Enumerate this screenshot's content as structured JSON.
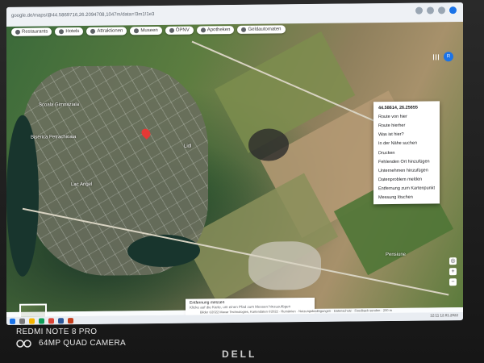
{
  "browser": {
    "url": "google.de/maps/@44.5869716,26.2094708,1047m/data=!3m1!1e3"
  },
  "map": {
    "chips": [
      {
        "label": "Restaurants",
        "icon": "fork-knife-icon"
      },
      {
        "label": "Hotels",
        "icon": "bed-icon"
      },
      {
        "label": "Attraktionen",
        "icon": "camera-icon"
      },
      {
        "label": "Museen",
        "icon": "museum-icon"
      },
      {
        "label": "ÖPNV",
        "icon": "bus-icon"
      },
      {
        "label": "Apotheken",
        "icon": "pharmacy-icon"
      },
      {
        "label": "Geldautomaten",
        "icon": "atm-icon"
      }
    ],
    "account_initial": "R",
    "places": [
      {
        "label": "Scoala Gimnaziala"
      },
      {
        "label": "Biserica Petrachioaia"
      },
      {
        "label": "Lac Angel"
      },
      {
        "label": "Lidl"
      },
      {
        "label": "Pensiune"
      }
    ]
  },
  "context_menu": {
    "coordinates": "44.58614, 26.25655",
    "items": [
      "Route von hier",
      "Route hierher",
      "Was ist hier?",
      "In der Nähe suchen",
      "Drucken",
      "Fehlenden Ort hinzufügen",
      "Unternehmen hinzufügen",
      "Datenproblem melden",
      "Entfernung zum Kartenpunkt",
      "Messung löschen"
    ]
  },
  "info_panel": {
    "title": "Entfernung messen",
    "description": "Klicke auf die Karte, um einen Pfad zum Messen hinzuzufügen"
  },
  "footer": {
    "text": "Bilder ©2022 Maxar Technologies, Kartendaten ©2022 · Rumänien · Nutzungsbedingungen · Datenschutz · Feedback senden · 200 m"
  },
  "taskbar": {
    "clock": "12:11  12.01.2022"
  },
  "photo": {
    "watermark_line1": "REDMI NOTE 8 PRO",
    "watermark_line2": "64MP QUAD CAMERA",
    "laptop_brand": "DELL"
  }
}
